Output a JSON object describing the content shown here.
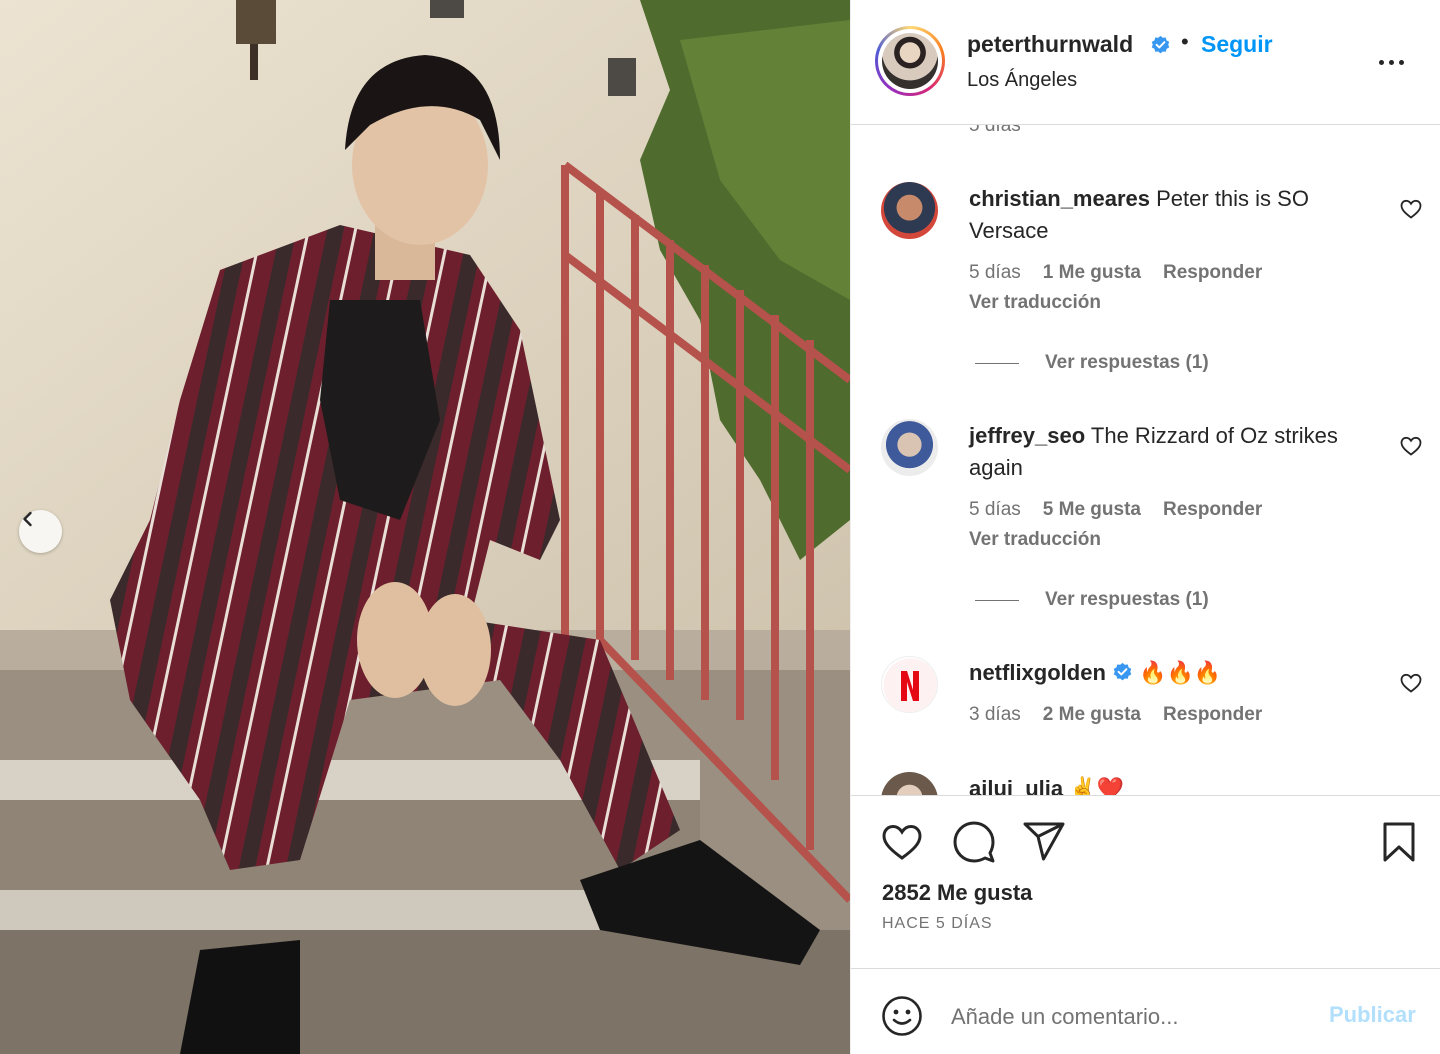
{
  "post": {
    "username": "peterthurnwald",
    "follow_label": "Seguir",
    "separator": "•",
    "location": "Los Ángeles",
    "photo_alt": "Foto de peterthurnwald"
  },
  "comments": {
    "cut_time": "5 días",
    "items": [
      {
        "username": "christian_meares",
        "text": "Peter this is SO Versace",
        "time": "5 días",
        "likes": "1 Me gusta",
        "reply": "Responder",
        "translate": "Ver traducción",
        "replies": "Ver respuestas (1)"
      },
      {
        "username": "jeffrey_seo",
        "text": "The Rizzard of Oz strikes again",
        "time": "5 días",
        "likes": "5 Me gusta",
        "reply": "Responder",
        "translate": "Ver traducción",
        "replies": "Ver respuestas (1)"
      },
      {
        "username": "netflixgolden",
        "text": "🔥🔥🔥",
        "time": "3 días",
        "likes": "2 Me gusta",
        "reply": "Responder"
      },
      {
        "username": "ailui_ulia",
        "text": "✌️❤️"
      }
    ]
  },
  "actions": {
    "likes_count": "2852 Me gusta",
    "posted_ago": "HACE 5 DÍAS"
  },
  "composer": {
    "placeholder": "Añade un comentario...",
    "publish_label": "Publicar"
  },
  "colors": {
    "accent": "#0095f6",
    "publish_disabled": "#b2dffc",
    "verified": "#3897f0"
  },
  "icons": [
    "chevron-left-icon",
    "verified-badge-icon",
    "more-options-icon",
    "heart-icon",
    "comment-icon",
    "share-icon",
    "bookmark-icon",
    "emoji-icon"
  ]
}
